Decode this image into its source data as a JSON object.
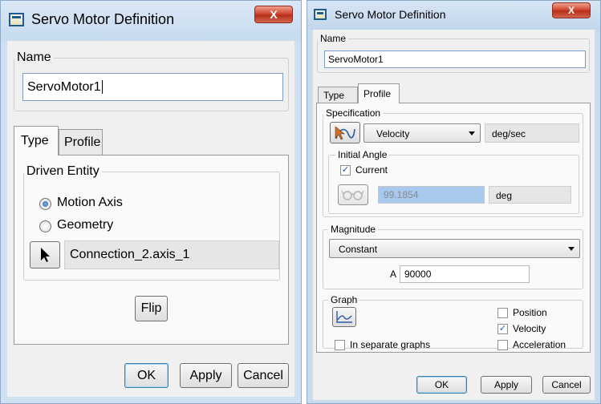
{
  "left_dialog": {
    "title": "Servo Motor Definition",
    "close_label": "X",
    "name_label": "Name",
    "name_value": "ServoMotor1",
    "tabs": [
      {
        "label": "Type"
      },
      {
        "label": "Profile"
      }
    ],
    "driven_entity_label": "Driven Entity",
    "motion_axis_label": "Motion Axis",
    "geometry_label": "Geometry",
    "connection_value": "Connection_2.axis_1",
    "flip_label": "Flip",
    "ok_label": "OK",
    "apply_label": "Apply",
    "cancel_label": "Cancel"
  },
  "right_dialog": {
    "title": "Servo Motor Definition",
    "close_label": "X",
    "name_label": "Name",
    "name_value": "ServoMotor1",
    "tabs": [
      {
        "label": "Type"
      },
      {
        "label": "Profile"
      }
    ],
    "specification_label": "Specification",
    "spec_type": "Velocity",
    "spec_unit": "deg/sec",
    "initial_angle_label": "Initial Angle",
    "current_label": "Current",
    "current_checked": true,
    "angle_value": "99.1854",
    "angle_unit": "deg",
    "magnitude_label": "Magnitude",
    "magnitude_type": "Constant",
    "a_label": "A",
    "a_value": "90000",
    "graph_label": "Graph",
    "position_label": "Position",
    "velocity_label": "Velocity",
    "acceleration_label": "Acceleration",
    "separate_graphs_label": "In separate graphs",
    "position_checked": false,
    "velocity_checked": true,
    "acceleration_checked": false,
    "separate_checked": false,
    "ok_label": "OK",
    "apply_label": "Apply",
    "cancel_label": "Cancel"
  },
  "colors": {
    "titlebar_left": "#cfe1f3",
    "titlebar_right": "#c4d8ee",
    "close_button": "#c94631",
    "selection_highlight": "#a9c8ee"
  },
  "icons": [
    "window-icon",
    "close-icon",
    "arrow-pointer-icon",
    "spline-select-icon",
    "glasses-icon",
    "graph-icon",
    "dropdown-arrow-icon"
  ]
}
